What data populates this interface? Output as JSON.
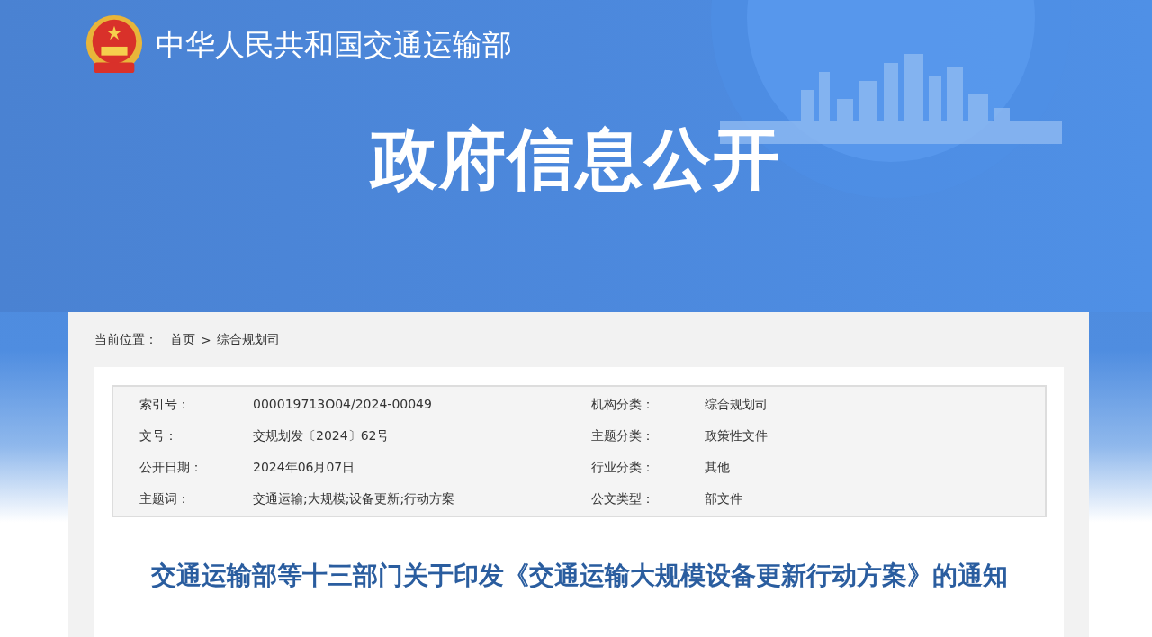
{
  "header": {
    "site_name": "中华人民共和国交通运输部",
    "section_title": "政府信息公开"
  },
  "breadcrumb": {
    "label": "当前位置：",
    "items": [
      {
        "text": "首页"
      },
      {
        "text": "综合规划司"
      }
    ],
    "separator": ">"
  },
  "meta": [
    {
      "label": "索引号：",
      "value": "000019713O04/2024-00049"
    },
    {
      "label": "机构分类：",
      "value": "综合规划司"
    },
    {
      "label": "文号：",
      "value": "交规划发〔2024〕62号"
    },
    {
      "label": "主题分类：",
      "value": "政策性文件"
    },
    {
      "label": "公开日期：",
      "value": "2024年06月07日"
    },
    {
      "label": "行业分类：",
      "value": "其他"
    },
    {
      "label": "主题词：",
      "value": "交通运输;大规模;设备更新;行动方案"
    },
    {
      "label": "公文类型：",
      "value": "部文件"
    }
  ],
  "article": {
    "title": "交通运输部等十三部门关于印发《交通运输大规模设备更新行动方案》的通知"
  }
}
